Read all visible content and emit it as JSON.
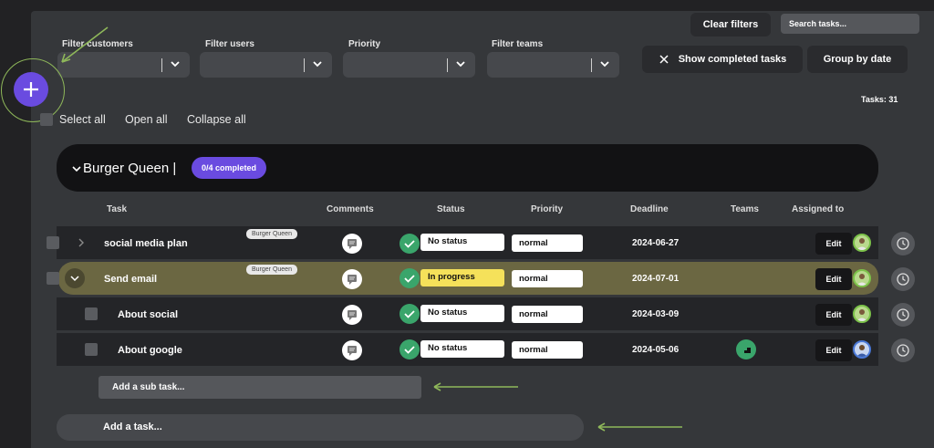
{
  "toolbar": {
    "clear_filters": "Clear filters",
    "search_placeholder": "Search tasks...",
    "show_completed": "Show completed tasks",
    "group_by_date": "Group by date",
    "tasks_count": "Tasks: 31"
  },
  "filters": [
    {
      "label": "Filter customers",
      "value": ""
    },
    {
      "label": "Filter users",
      "value": ""
    },
    {
      "label": "Priority",
      "value": ""
    },
    {
      "label": "Filter teams",
      "value": ""
    }
  ],
  "bulk_actions": {
    "select_all": "Select all",
    "open_all": "Open all",
    "collapse_all": "Collapse all"
  },
  "group": {
    "title": "Burger Queen |",
    "badge": "0/4 completed"
  },
  "columns": {
    "task": "Task",
    "comments": "Comments",
    "status": "Status",
    "priority": "Priority",
    "deadline": "Deadline",
    "teams": "Teams",
    "assigned_to": "Assigned to"
  },
  "rows": [
    {
      "name": "social media plan",
      "customer": "Burger Queen",
      "status": "No status",
      "priority": "normal",
      "deadline": "2024-06-27",
      "edit": "Edit"
    },
    {
      "name": "Send email",
      "customer": "Burger Queen",
      "status": "In progress",
      "priority": "normal",
      "deadline": "2024-07-01",
      "edit": "Edit"
    },
    {
      "name": "About social",
      "status": "No status",
      "priority": "normal",
      "deadline": "2024-03-09",
      "edit": "Edit"
    },
    {
      "name": "About google",
      "status": "No status",
      "priority": "normal",
      "deadline": "2024-05-06",
      "edit": "Edit"
    }
  ],
  "add_sub_task": "Add a sub task...",
  "add_task": "Add a task...",
  "colors": {
    "accent": "#6a4be0",
    "status_green": "#3aa56b",
    "in_progress_yellow": "#f5e15a",
    "annotation_green": "#8fb85a"
  }
}
